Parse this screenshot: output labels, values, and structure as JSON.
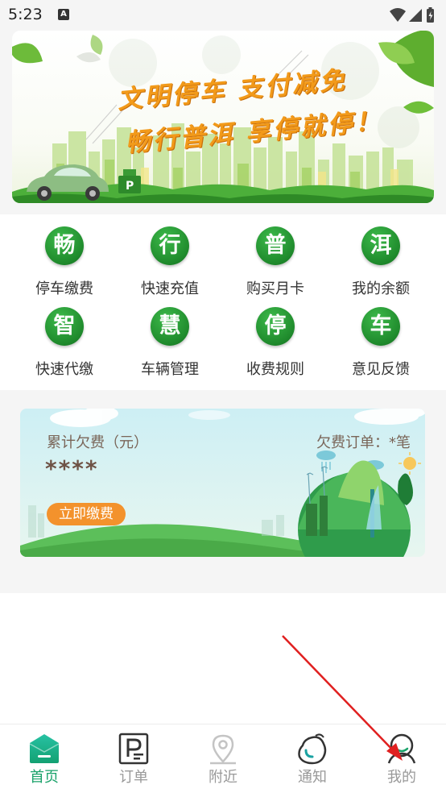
{
  "status_bar": {
    "time": "5:23",
    "notification_badge": "A",
    "icons": [
      "wifi-icon",
      "signal-icon",
      "battery-charging-icon"
    ]
  },
  "banner": {
    "line1": "文明停车 支付减免",
    "line2": "畅行普洱 享停就停！"
  },
  "services": [
    {
      "badge": "畅",
      "label": "停车缴费"
    },
    {
      "badge": "行",
      "label": "快速充值"
    },
    {
      "badge": "普",
      "label": "购买月卡"
    },
    {
      "badge": "洱",
      "label": "我的余额"
    },
    {
      "badge": "智",
      "label": "快速代缴"
    },
    {
      "badge": "慧",
      "label": "车辆管理"
    },
    {
      "badge": "停",
      "label": "收费规则"
    },
    {
      "badge": "车",
      "label": "意见反馈"
    }
  ],
  "arrears": {
    "title": "累计欠费（元）",
    "orders_label": "欠费订单：*笔",
    "amount": "****",
    "pay_button": "立即缴费"
  },
  "bottom_nav": [
    {
      "label": "首页",
      "icon": "home-icon",
      "active": true
    },
    {
      "label": "订单",
      "icon": "parking-ticket-icon",
      "active": false
    },
    {
      "label": "附近",
      "icon": "location-pin-icon",
      "active": false
    },
    {
      "label": "通知",
      "icon": "notification-icon",
      "active": false
    },
    {
      "label": "我的",
      "icon": "user-icon",
      "active": false
    }
  ],
  "colors": {
    "brand_green": "#1f8a2c",
    "nav_active": "#1aa26a",
    "pay_orange": "#f3922c",
    "banner_text": "#f29a1a",
    "annotation_arrow": "#e02020"
  }
}
